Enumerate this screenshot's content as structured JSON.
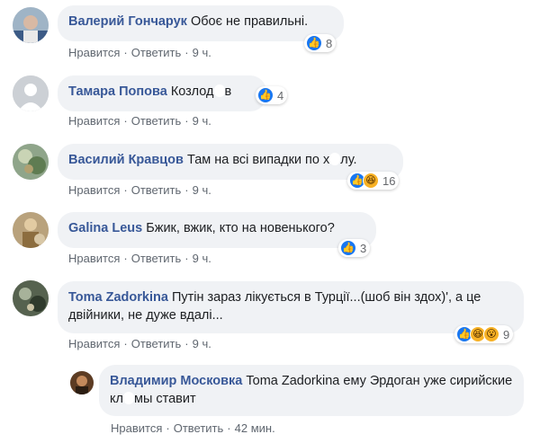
{
  "comments": [
    {
      "author": "Валерий Гончарук",
      "text": "Обоє не правильні.",
      "like_label": "Нравится",
      "reply_label": "Ответить",
      "time": "9 ч.",
      "reaction_count": "8",
      "reactions": [
        "like-icon"
      ]
    },
    {
      "author": "Тамара Попова",
      "text_before": "Козлод",
      "text_after": "в",
      "like_label": "Нравится",
      "reply_label": "Ответить",
      "time": "9 ч.",
      "reaction_count": "4",
      "reactions": [
        "like-icon"
      ]
    },
    {
      "author": "Василий Кравцов",
      "text_before": "Там на всі випадки по х",
      "text_after": "лу.",
      "like_label": "Нравится",
      "reply_label": "Ответить",
      "time": "9 ч.",
      "reaction_count": "16",
      "reactions": [
        "like-icon",
        "haha-icon"
      ]
    },
    {
      "author": "Galina Leus",
      "text": "Бжик, вжик, кто на новенького?",
      "like_label": "Нравится",
      "reply_label": "Ответить",
      "time": "9 ч.",
      "reaction_count": "3",
      "reactions": [
        "like-icon"
      ]
    },
    {
      "author": "Toma Zadorkina",
      "text": "Путін зараз лікується в Турції...(шоб він здох)', а це двійники, не дуже вдалі...",
      "like_label": "Нравится",
      "reply_label": "Ответить",
      "time": "9 ч.",
      "reaction_count": "9",
      "reactions": [
        "like-icon",
        "haha-icon",
        "wow-icon"
      ]
    }
  ],
  "reply": {
    "author": "Владимир Московка",
    "text_before": "Toma Zadorkina ему Эрдоган уже сирийские кл",
    "text_after": "мы ставит",
    "like_label": "Нравится",
    "reply_label": "Ответить",
    "time": "42 мин."
  },
  "colors": {
    "author": "#385898",
    "bubble": "#f0f2f5",
    "meta": "#606770",
    "like_blue": "#1877f2",
    "emoji_yellow": "#f7b125"
  }
}
